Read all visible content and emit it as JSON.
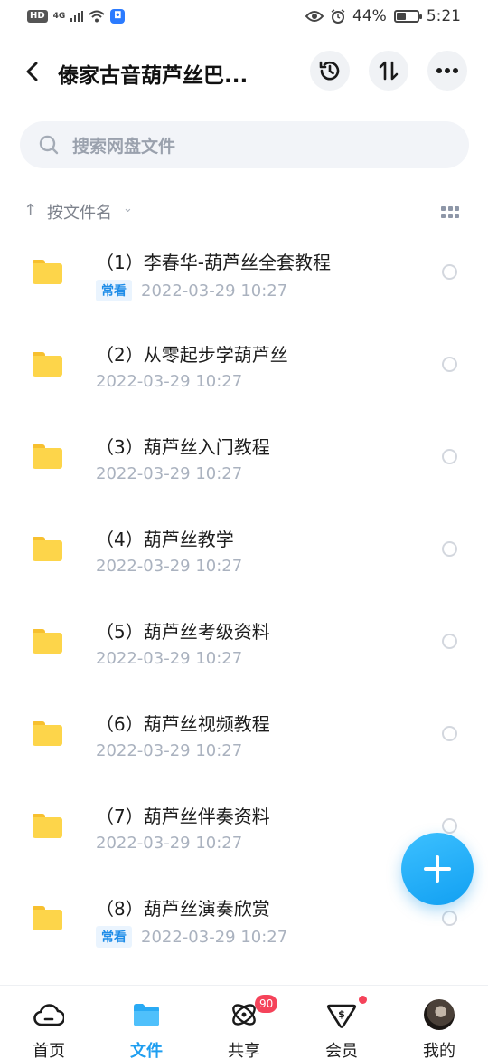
{
  "status_bar": {
    "hd": "HD",
    "network": "4G",
    "battery": "44%",
    "battery_level": 0.44,
    "time": "5:21"
  },
  "header": {
    "title": "傣家古音葫芦丝巴...",
    "icons": [
      "back-arrow-icon",
      "history-icon",
      "sort-arrows-icon",
      "more-icon"
    ]
  },
  "search": {
    "placeholder": "搜索网盘文件"
  },
  "sort": {
    "label": "按文件名"
  },
  "files": [
    {
      "name": "（1）李春华-葫芦丝全套教程",
      "badge": "常看",
      "date": "2022-03-29  10:27"
    },
    {
      "name": "（2）从零起步学葫芦丝",
      "badge": "",
      "date": "2022-03-29  10:27"
    },
    {
      "name": "（3）葫芦丝入门教程",
      "badge": "",
      "date": "2022-03-29  10:27"
    },
    {
      "name": "（4）葫芦丝教学",
      "badge": "",
      "date": "2022-03-29  10:27"
    },
    {
      "name": "（5）葫芦丝考级资料",
      "badge": "",
      "date": "2022-03-29  10:27"
    },
    {
      "name": "（6）葫芦丝视频教程",
      "badge": "",
      "date": "2022-03-29  10:27"
    },
    {
      "name": "（7）葫芦丝伴奏资料",
      "badge": "",
      "date": "2022-03-29  10:27"
    },
    {
      "name": "（8）葫芦丝演奏欣赏",
      "badge": "常看",
      "date": "2022-03-29  10:27"
    }
  ],
  "nav": {
    "items": [
      {
        "label": "首页",
        "icon": "cloud-home-icon"
      },
      {
        "label": "文件",
        "icon": "folder-icon",
        "active": true
      },
      {
        "label": "共享",
        "icon": "share-atom-icon"
      },
      {
        "label": "会员",
        "icon": "vip-shield-icon"
      },
      {
        "label": "我的",
        "icon": "avatar"
      }
    ],
    "share_badge": "90"
  },
  "colors": {
    "accent": "#1e9ef0",
    "folder": "#fdd54a",
    "badge_red": "#f5435a"
  }
}
